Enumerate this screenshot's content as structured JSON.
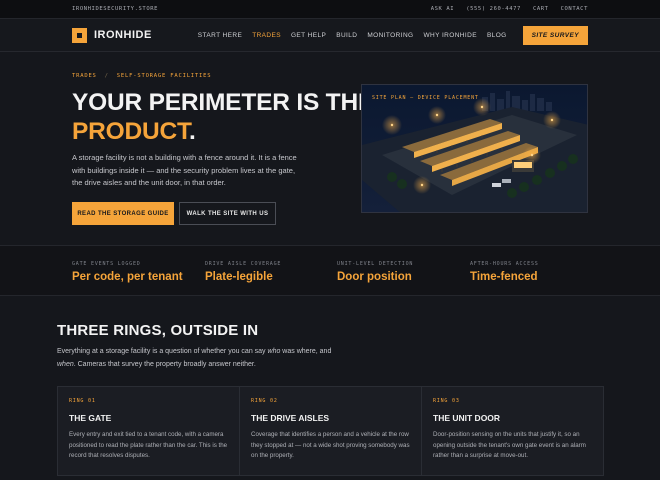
{
  "topbar": {
    "domain": "IRONHIDESECURITY.STORE",
    "links": [
      "ASK AI",
      "(555) 260-4477",
      "CART",
      "CONTACT"
    ]
  },
  "header": {
    "brand": "IRONHIDE",
    "nav": [
      "START HERE",
      "TRADES",
      "GET HELP",
      "BUILD",
      "MONITORING",
      "WHY IRONHIDE",
      "BLOG"
    ],
    "active_nav": "TRADES",
    "cta": "SITE SURVEY"
  },
  "hero": {
    "breadcrumb": [
      "TRADES",
      "/",
      "SELF-STORAGE FACILITIES"
    ],
    "title_line1": "YOUR PERIMETER IS THE",
    "title_accent": "PRODUCT",
    "title_period": ".",
    "text": "A storage facility is not a building with a fence around it. It is a fence with buildings inside it — and the security problem lives at the gate, the drive aisles and the unit door, in that order.",
    "primary_button": "READ THE STORAGE GUIDE",
    "secondary_button": "WALK THE SITE WITH US",
    "image_caption": "SITE PLAN — DEVICE PLACEMENT"
  },
  "stats": [
    {
      "label": "GATE EVENTS LOGGED",
      "value": "Per code, per tenant"
    },
    {
      "label": "DRIVE AISLE COVERAGE",
      "value": "Plate-legible"
    },
    {
      "label": "UNIT-LEVEL DETECTION",
      "value": "Door position"
    },
    {
      "label": "AFTER-HOURS ACCESS",
      "value": "Time-fenced"
    }
  ],
  "rings": {
    "title": "THREE RINGS, OUTSIDE IN",
    "intro_pre": "Everything at a storage facility is a question of whether you can say ",
    "intro_who": "who",
    "intro_mid": " was where, and ",
    "intro_when": "when",
    "intro_post": ". Cameras that survey the property broadly answer neither.",
    "cards": [
      {
        "ring": "RING 01",
        "title": "THE GATE",
        "text": "Every entry and exit tied to a tenant code, with a camera positioned to read the plate rather than the car. This is the record that resolves disputes."
      },
      {
        "ring": "RING 02",
        "title": "THE DRIVE AISLES",
        "text": "Coverage that identifies a person and a vehicle at the row they stopped at — not a wide shot proving somebody was on the property."
      },
      {
        "ring": "RING 03",
        "title": "THE UNIT DOOR",
        "text": "Door-position sensing on the units that justify it, so an opening outside the tenant's own gate event is an alarm rather than a surprise at move-out."
      }
    ]
  },
  "colors": {
    "accent": "#f5a43a",
    "background": "#15171c",
    "text": "#e6e6e6"
  }
}
